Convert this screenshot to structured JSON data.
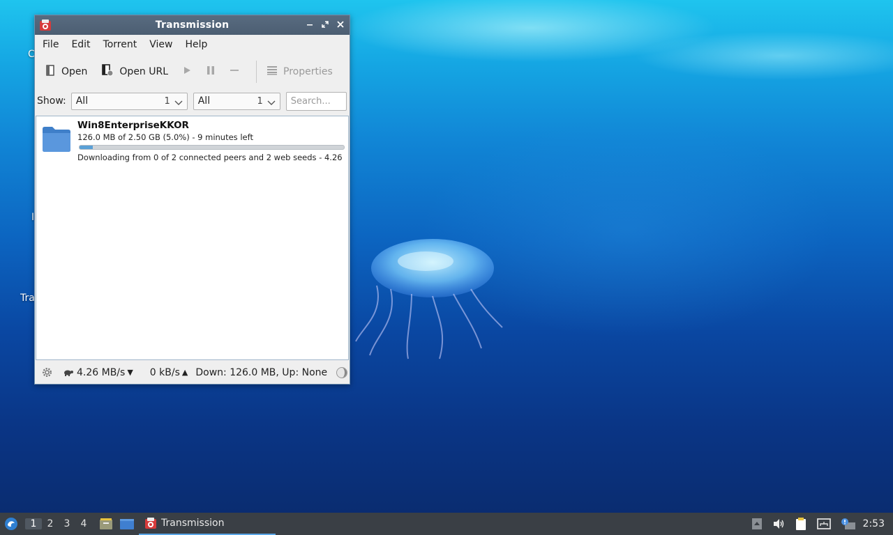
{
  "window": {
    "title": "Transmission",
    "controls": [
      "minimize",
      "maximize",
      "close"
    ]
  },
  "menu": [
    "File",
    "Edit",
    "Torrent",
    "View",
    "Help"
  ],
  "toolbar": {
    "open_label": "Open",
    "open_url_label": "Open URL",
    "properties_label": "Properties"
  },
  "filter": {
    "show_label": "Show:",
    "activity": {
      "value": "All",
      "count": "1"
    },
    "tracker": {
      "value": "All",
      "count": "1"
    },
    "search_placeholder": "Search..."
  },
  "torrents": [
    {
      "name": "Win8EnterpriseKKOR",
      "progress_text": "126.0 MB of 2.50 GB (5.0%) - 9 minutes left",
      "progress_fraction": 0.05,
      "status": "Downloading from 0 of 2 connected peers and 2 web seeds - 4.26 M..."
    }
  ],
  "statusbar": {
    "down_speed": "4.26 MB/s",
    "up_speed": "0 kB/s",
    "totals": "Down: 126.0 MB, Up: None"
  },
  "desktop": {
    "label_fragment": "Tra"
  },
  "taskbar": {
    "desktops": [
      "1",
      "2",
      "3",
      "4"
    ],
    "active_desktop": "1",
    "task_label": "Transmission",
    "clock": "2:53"
  },
  "colors": {
    "titlebar": "#4c5e72",
    "taskbar": "#3a3f45",
    "progress": "#5aa0d6",
    "folder": "#4a88d0"
  }
}
